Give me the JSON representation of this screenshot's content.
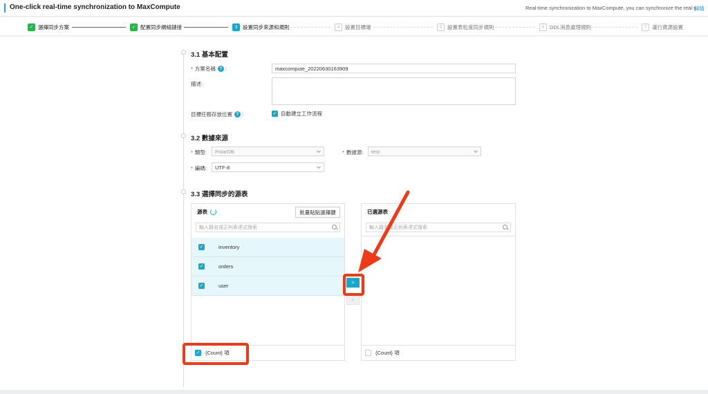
{
  "header": {
    "title": "One-click real-time synchronization to MaxCompute",
    "description": "Real-time synchronization to MaxCompute, you can synchronize the real-ti...",
    "details_link": "詳情"
  },
  "steps": [
    {
      "num": "✓",
      "label": "選擇同步方案",
      "state": "done"
    },
    {
      "num": "✓",
      "label": "配置同步網絡鏈接",
      "state": "done"
    },
    {
      "num": "3",
      "label": "設置同步來源和規則",
      "state": "active"
    },
    {
      "num": "4",
      "label": "設置目標端",
      "state": "todo"
    },
    {
      "num": "5",
      "label": "設置表粒度同步規則",
      "state": "todo"
    },
    {
      "num": "6",
      "label": "DDL消息處理規則",
      "state": "todo"
    },
    {
      "num": "7",
      "label": "運行資源設置",
      "state": "todo"
    }
  ],
  "basic": {
    "title": "3.1 基本配置",
    "name_label": "方案名稱",
    "name_value": "maxcompute_20220630163909",
    "desc_label": "描述:",
    "location_label": "目標任務存放位置",
    "auto_create_label": "自動建立工作流程"
  },
  "source": {
    "title": "3.2 數據來源",
    "type_label": "類型:",
    "type_value": "PolarDB",
    "datasource_label": "數據源:",
    "datasource_value": "test",
    "encoding_label": "編碼:",
    "encoding_value": "UTF-8"
  },
  "tables": {
    "title": "3.3 選擇同步的源表",
    "source_header": "源表",
    "batch_button": "批量貼貼選擇鍵",
    "search_placeholder": "輸入籍名或正則表達式搜索",
    "rows": [
      "inventory",
      "orders",
      "user"
    ],
    "source_footer": "{Count} 項",
    "selected_header": "已選源表",
    "selected_footer": "{Count} 項",
    "move_right": ">",
    "move_left": "<"
  },
  "colors": {
    "accent": "#1aa6c9",
    "done": "#2bb24c",
    "highlight": "#f03a17"
  }
}
